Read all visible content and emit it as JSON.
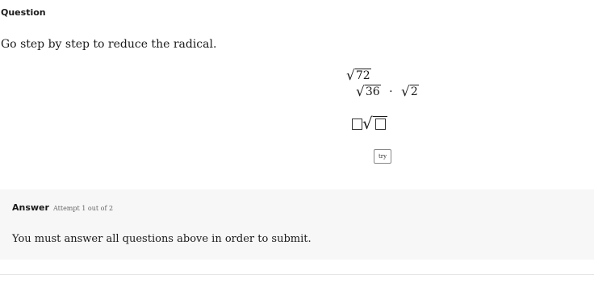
{
  "question": {
    "heading": "Question",
    "prompt": "Go step by step to reduce the radical."
  },
  "work": {
    "line1_radicand": "72",
    "line2_left_radicand": "36",
    "line2_operator": "·",
    "line2_right_radicand": "2"
  },
  "try_button_label": "try",
  "answer": {
    "title": "Answer",
    "attempt_text": "Attempt 1 out of 2",
    "message": "You must answer all questions above in order to submit."
  }
}
